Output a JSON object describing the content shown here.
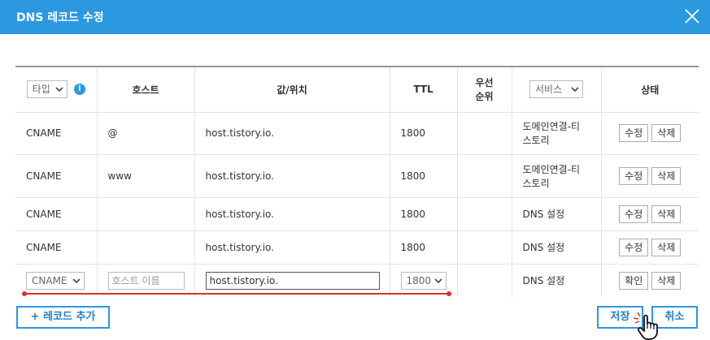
{
  "dialog": {
    "title": "DNS 레코드 수정"
  },
  "icons": {
    "close": "close-icon",
    "info": "info-icon",
    "chevron": "chevron-down-icon",
    "cursor": "hand-pointer-icon"
  },
  "colors": {
    "accent": "#2c98e0",
    "highlight": "#d9302c"
  },
  "header": {
    "type_select": "타입",
    "info_glyph": "i",
    "host": "호스트",
    "value": "값/위치",
    "ttl": "TTL",
    "priority_line1": "우선",
    "priority_line2": "순위",
    "service_select": "서비스",
    "status": "상태"
  },
  "rows": [
    {
      "type": "CNAME",
      "host": "@",
      "value": "host.tistory.io.",
      "ttl": "1800",
      "priority": "",
      "service_line1": "도메인연결-티",
      "service_line2": "스토리",
      "btn1": "수정",
      "btn2": "삭제"
    },
    {
      "type": "CNAME",
      "host": "www",
      "value": "host.tistory.io.",
      "ttl": "1800",
      "priority": "",
      "service_line1": "도메인연결-티",
      "service_line2": "스토리",
      "btn1": "수정",
      "btn2": "삭제"
    },
    {
      "type": "CNAME",
      "host": "",
      "value": "host.tistory.io.",
      "ttl": "1800",
      "priority": "",
      "service": "DNS 설정",
      "btn1": "수정",
      "btn2": "삭제"
    },
    {
      "type": "CNAME",
      "host": "",
      "value": "host.tistory.io.",
      "ttl": "1800",
      "priority": "",
      "service": "DNS 설정",
      "btn1": "수정",
      "btn2": "삭제"
    }
  ],
  "edit_row": {
    "type_value": "CNAME",
    "host_placeholder": "호스트 이름",
    "value_input": "host.tistory.io.",
    "ttl_value": "1800",
    "service": "DNS 설정",
    "confirm_label": "확인",
    "delete_label": "삭제"
  },
  "footer": {
    "add_label": "+ 레코드 추가",
    "save_label": "저장",
    "cancel_label": "취소"
  }
}
